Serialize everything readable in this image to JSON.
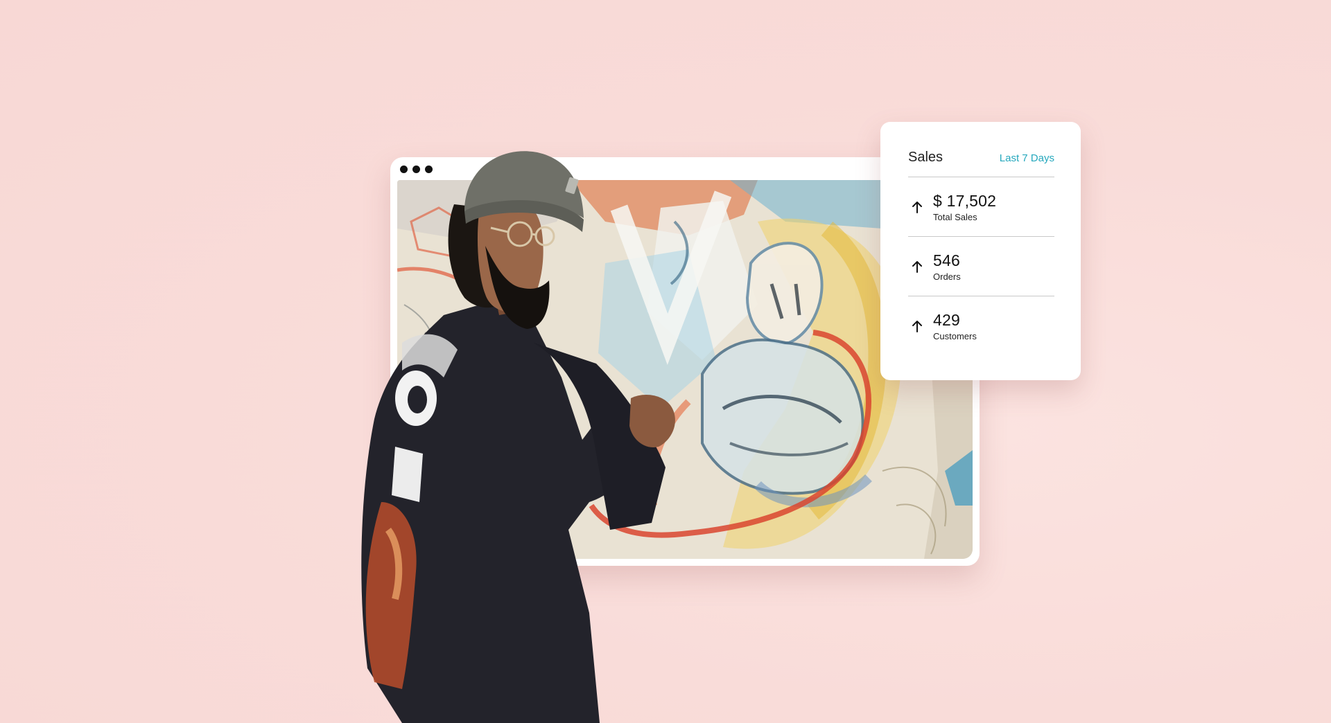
{
  "colors": {
    "background": "#f9dcd9",
    "card": "#ffffff",
    "accent": "#25a8bd",
    "divider": "#c9c9c9",
    "text": "#111111"
  },
  "illustration": {
    "window": "browser-window",
    "content": "painting"
  },
  "sales_card": {
    "title": "Sales",
    "range": "Last 7 Days",
    "metrics": [
      {
        "icon": "arrow-up-icon",
        "value": "$ 17,502",
        "label": "Total Sales"
      },
      {
        "icon": "arrow-up-icon",
        "value": "546",
        "label": "Orders"
      },
      {
        "icon": "arrow-up-icon",
        "value": "429",
        "label": "Customers"
      }
    ]
  }
}
